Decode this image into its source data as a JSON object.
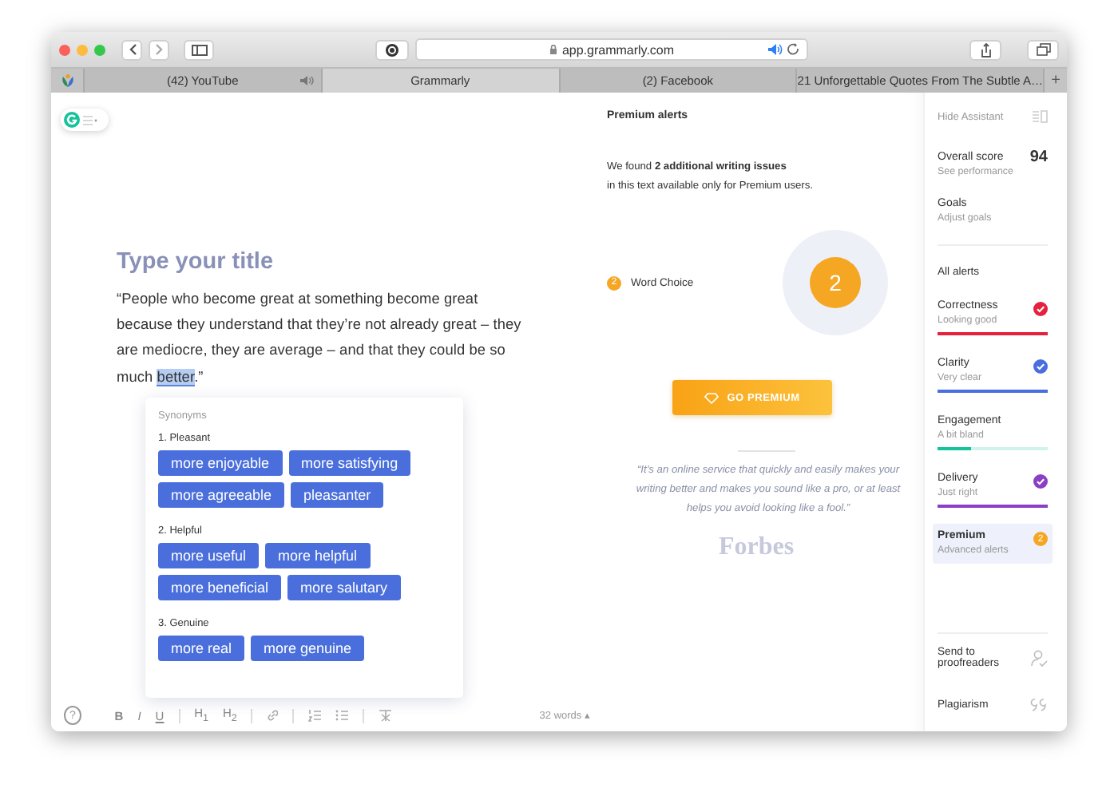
{
  "browser": {
    "url": "app.grammarly.com",
    "new_tab": "+",
    "tabs": [
      {
        "label": "(42) YouTube",
        "selected": false,
        "audio": true
      },
      {
        "label": "Grammarly",
        "selected": true,
        "audio": false
      },
      {
        "label": "(2) Facebook",
        "selected": false,
        "audio": false
      },
      {
        "label": "21 Unforgettable Quotes From The Subtle A…",
        "selected": false,
        "audio": false
      }
    ]
  },
  "editor": {
    "title_placeholder": "Type your title",
    "paragraph": {
      "before": "“People who become great at something become great because they understand that they’re not already great – they are mediocre, they are average – and that they could be so much ",
      "highlight": "better",
      "after": ".”"
    },
    "synonyms": {
      "heading": "Synonyms",
      "groups": [
        {
          "label": "1. Pleasant",
          "words": [
            "more enjoyable",
            "more satisfying",
            "more agreeable",
            "pleasanter"
          ]
        },
        {
          "label": "2. Helpful",
          "words": [
            "more useful",
            "more helpful",
            "more beneficial",
            "more salutary"
          ]
        },
        {
          "label": "3. Genuine",
          "words": [
            "more real",
            "more genuine"
          ]
        }
      ]
    },
    "help": "?",
    "format_buttons": [
      "B",
      "I",
      "U",
      "H$_{1}$",
      "H$_{2}$"
    ],
    "word_count": "32 words ▴"
  },
  "premium": {
    "title": "Premium alerts",
    "message": [
      "We found **2 additional writing issues**",
      "in this text available only for Premium users."
    ],
    "categories": [
      {
        "label": "Word Choice",
        "count": "2"
      }
    ],
    "total": "2",
    "button": "GO PREMIUM",
    "quote": "“It’s an online service that quickly and easily makes your writing better and makes you sound like a pro, or at least helps you avoid looking like a fool.”",
    "quote_source": "Forbes"
  },
  "sidebar": {
    "hide": "Hide Assistant",
    "score_label": "Overall score",
    "score": "94",
    "score_link": "See performance",
    "goals": "Goals",
    "goals_link": "Adjust goals",
    "alerts_heading": "All alerts",
    "alerts": [
      {
        "kind": "check",
        "name": "Correctness",
        "status": "Looking good",
        "color": "#e5213e",
        "level": 1,
        "selected": false
      },
      {
        "kind": "check",
        "name": "Clarity",
        "status": "Very clear",
        "color": "#4a6ee0",
        "level": 1,
        "selected": false
      },
      {
        "kind": "plain",
        "name": "Engagement",
        "status": "A bit bland",
        "color": "#15c39a",
        "level": 0.3,
        "selected": false
      },
      {
        "kind": "check",
        "name": "Delivery",
        "status": "Just right",
        "color": "#8b3fc4",
        "level": 1,
        "selected": false
      },
      {
        "kind": "count",
        "name": "Premium",
        "status": "Advanced alerts",
        "color": "#f5a623",
        "count": "2",
        "selected": true
      }
    ],
    "tools": [
      {
        "kind": "proofread",
        "label": "Send to proofreaders"
      },
      {
        "kind": "plagiarism",
        "label": "Plagiarism"
      }
    ]
  }
}
